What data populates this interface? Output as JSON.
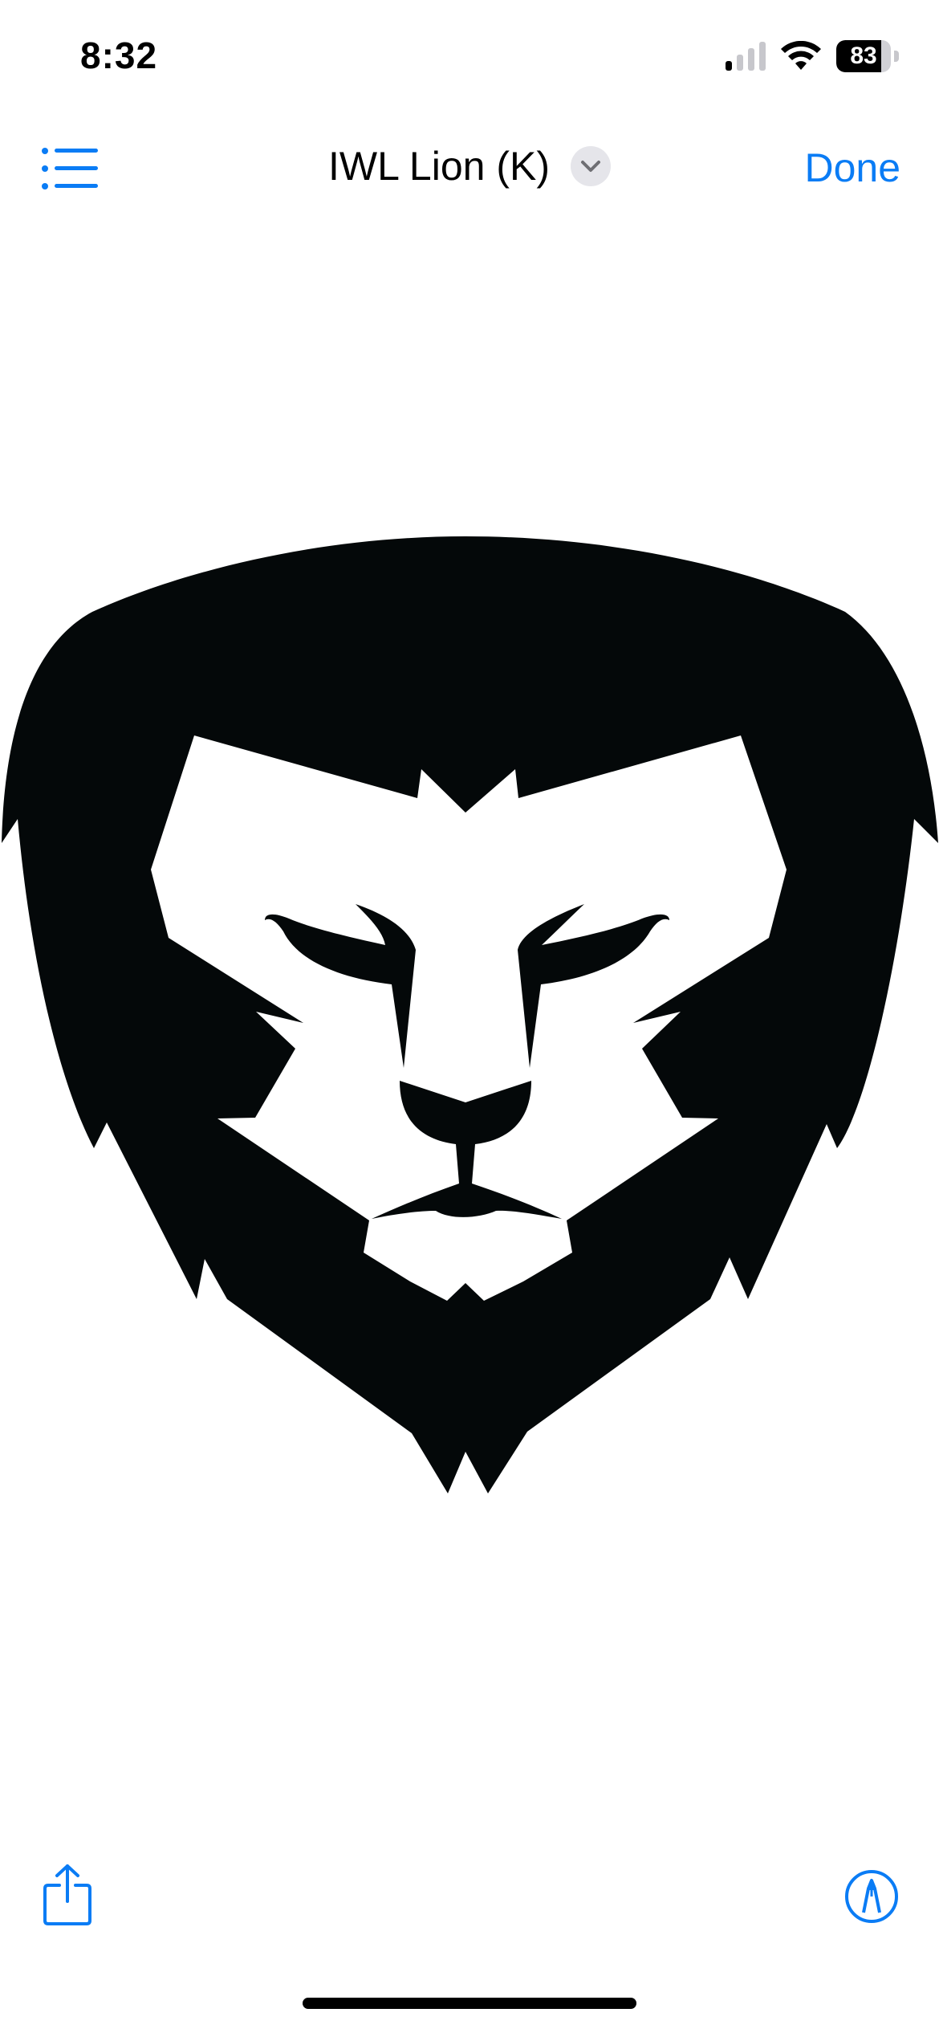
{
  "status_bar": {
    "time": "8:32",
    "signal_bars_active": 1,
    "signal_bars_total": 4,
    "battery_level": 83,
    "battery_text": "83"
  },
  "nav": {
    "title": "IWL Lion (K)",
    "done_label": "Done",
    "left_icon": "list-icon",
    "title_icon": "chevron-down-icon"
  },
  "content": {
    "image": "lion-head-logo"
  },
  "toolbar": {
    "left_icon": "share-icon",
    "right_icon": "markup-icon"
  },
  "colors": {
    "accent": "#0a7cf5",
    "logo": "#040809",
    "background": "#ffffff"
  }
}
